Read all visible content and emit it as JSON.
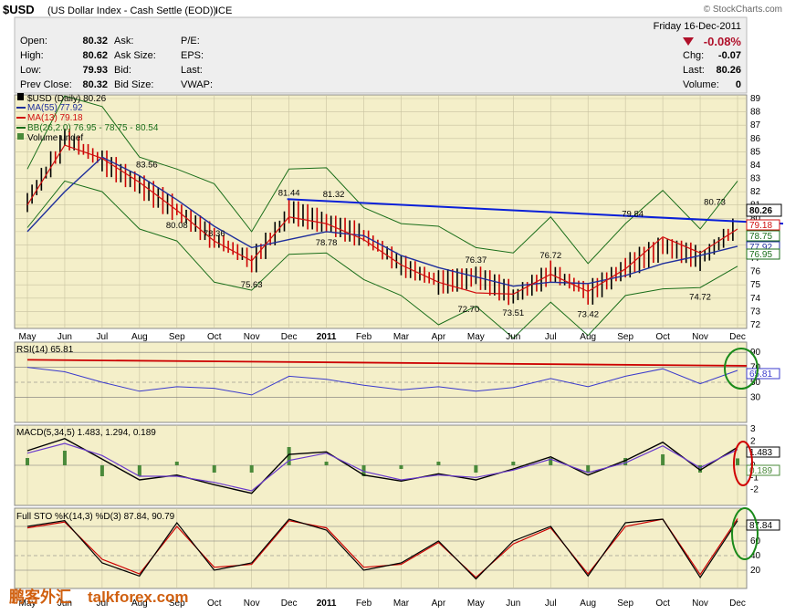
{
  "header": {
    "ticker": "$USD",
    "description": "(US Dollar Index - Cash Settle (EOD))",
    "exchange": "ICE",
    "watermark": "© StockCharts.com",
    "date": "Friday 16-Dec-2011",
    "change_pct": "-0.08%",
    "quote": {
      "open_label": "Open:",
      "open": "80.32",
      "high_label": "High:",
      "high": "80.62",
      "low_label": "Low:",
      "low": "79.93",
      "prev_label": "Prev Close:",
      "prev": "80.32",
      "ask_label": "Ask:",
      "ask_size_label": "Ask Size:",
      "bid_label": "Bid:",
      "bid_size_label": "Bid Size:",
      "pe_label": "P/E:",
      "eps_label": "EPS:",
      "last_label": "Last:",
      "vwap_label": "VWAP:",
      "chg_label": "Chg:",
      "chg": "-0.07",
      "last2_label": "Last:",
      "last2": "80.26",
      "volume_label": "Volume:",
      "volume": "0"
    }
  },
  "legend": {
    "main": "$USD (Daily) 80.26",
    "ma55": "MA(55) 77.92",
    "ma13": "MA(13) 79.18",
    "bb": "BB(26,2.0) 76.95 - 78.75 - 80.54",
    "vol": "Volume undef",
    "rsi": "RSI(14) 65.81",
    "macd": "MACD(5,34,5) 1.483, 1.294, 0.189",
    "sto": "Full STO %K(14,3) %D(3) 87.84, 90.79"
  },
  "price_tags": [
    "80.26",
    "79.18",
    "78.75",
    "77.92",
    "76.95"
  ],
  "rsi_tag": "65.81",
  "macd_tags": [
    "1.483",
    "0.189"
  ],
  "sto_tag": "87.84",
  "colors": {
    "panel_bg": "#f4efc9",
    "grid": "#c8c2a0",
    "price_up": "#000000",
    "price_down": "#cc0000",
    "ma55": "#1f2f9c",
    "ma13": "#d01010",
    "bb": "#1a6e1a",
    "trendline": "#0a20d8",
    "rsi": "#3a3acc",
    "rsi_trend": "#cc0000",
    "stoK": "#000000",
    "stoD": "#cc0000",
    "circle_green": "#1a8a1a",
    "circle_red": "#d00000"
  },
  "chart_data": [
    {
      "type": "line",
      "title": "$USD (Daily)",
      "x": [
        "May",
        "Jun",
        "Jul",
        "Aug",
        "Sep",
        "Oct",
        "Nov",
        "Dec",
        "2011",
        "Feb",
        "Mar",
        "Apr",
        "May",
        "Jun",
        "Jul",
        "Aug",
        "Sep",
        "Oct",
        "Nov",
        "Dec"
      ],
      "ylim": [
        72,
        89
      ],
      "yticks": [
        72,
        73,
        74,
        75,
        76,
        77,
        78,
        79,
        80,
        81,
        82,
        83,
        84,
        85,
        86,
        87,
        88,
        89
      ],
      "series": [
        {
          "name": "$USD (Daily)",
          "values": [
            81.5,
            86,
            84.2,
            82.4,
            80.5,
            78.4,
            76.8,
            80.5,
            79.6,
            78.6,
            76.4,
            75.2,
            75.6,
            74.2,
            75.9,
            74.4,
            76.4,
            77.9,
            77.0,
            79.6
          ]
        },
        {
          "name": "MA(55)",
          "values": [
            79,
            82,
            84.6,
            83.2,
            81.4,
            79.4,
            77.8,
            78.4,
            79.0,
            78.7,
            77.2,
            76.3,
            75.6,
            74.9,
            75.2,
            75.1,
            75.7,
            76.6,
            77.2,
            77.9
          ]
        },
        {
          "name": "MA(13)",
          "values": [
            81,
            85.5,
            84.5,
            82.7,
            80.6,
            78.3,
            76.8,
            80.1,
            79.6,
            78.4,
            76.5,
            75.2,
            74.4,
            74.3,
            75.8,
            74.5,
            76.2,
            78.6,
            77.4,
            79.2
          ]
        }
      ],
      "annotations": [
        "83.56",
        "80.08",
        "78.36",
        "75.63",
        "81.44",
        "78.78",
        "81.32",
        "76.37",
        "72.70",
        "73.51",
        "76.72",
        "73.42",
        "79.84",
        "74.72",
        "80.73"
      ]
    },
    {
      "type": "line",
      "title": "RSI(14)",
      "ylim": [
        0,
        100
      ],
      "yticks": [
        30,
        50,
        70,
        90
      ],
      "series": [
        {
          "name": "RSI(14)",
          "values": [
            70,
            64,
            50,
            38,
            44,
            42,
            33,
            58,
            54,
            46,
            40,
            44,
            38,
            43,
            55,
            44,
            58,
            68,
            48,
            65.81
          ]
        }
      ]
    },
    {
      "type": "line",
      "title": "MACD(5,34,5)",
      "ylim": [
        -3,
        3
      ],
      "yticks": [
        -2,
        -1,
        0,
        1,
        2,
        3
      ],
      "series": [
        {
          "name": "MACD",
          "values": [
            1.2,
            2.2,
            0.5,
            -1.2,
            -0.8,
            -1.6,
            -2.3,
            0.9,
            1.1,
            -0.8,
            -1.3,
            -0.7,
            -1.2,
            -0.3,
            0.7,
            -0.8,
            0.4,
            1.9,
            -0.4,
            1.483
          ]
        },
        {
          "name": "Signal",
          "values": [
            1.0,
            1.8,
            0.8,
            -0.9,
            -0.9,
            -1.4,
            -2.1,
            0.4,
            1.0,
            -0.5,
            -1.2,
            -0.8,
            -1.0,
            -0.4,
            0.5,
            -0.6,
            0.2,
            1.6,
            -0.2,
            1.294
          ]
        }
      ]
    },
    {
      "type": "line",
      "title": "Full STO %K(14,3) %D(3)",
      "ylim": [
        0,
        100
      ],
      "yticks": [
        20,
        40,
        60,
        80
      ],
      "series": [
        {
          "name": "%K",
          "values": [
            80,
            88,
            30,
            12,
            85,
            20,
            30,
            90,
            75,
            20,
            30,
            60,
            8,
            60,
            80,
            12,
            85,
            90,
            10,
            87.84
          ]
        },
        {
          "name": "%D",
          "values": [
            78,
            86,
            35,
            15,
            80,
            24,
            28,
            88,
            78,
            24,
            28,
            58,
            10,
            56,
            78,
            15,
            80,
            90,
            14,
            90.79
          ]
        }
      ]
    }
  ],
  "footer": {
    "logo_cn": "鹏客外汇",
    "site": "talkforex.com"
  }
}
